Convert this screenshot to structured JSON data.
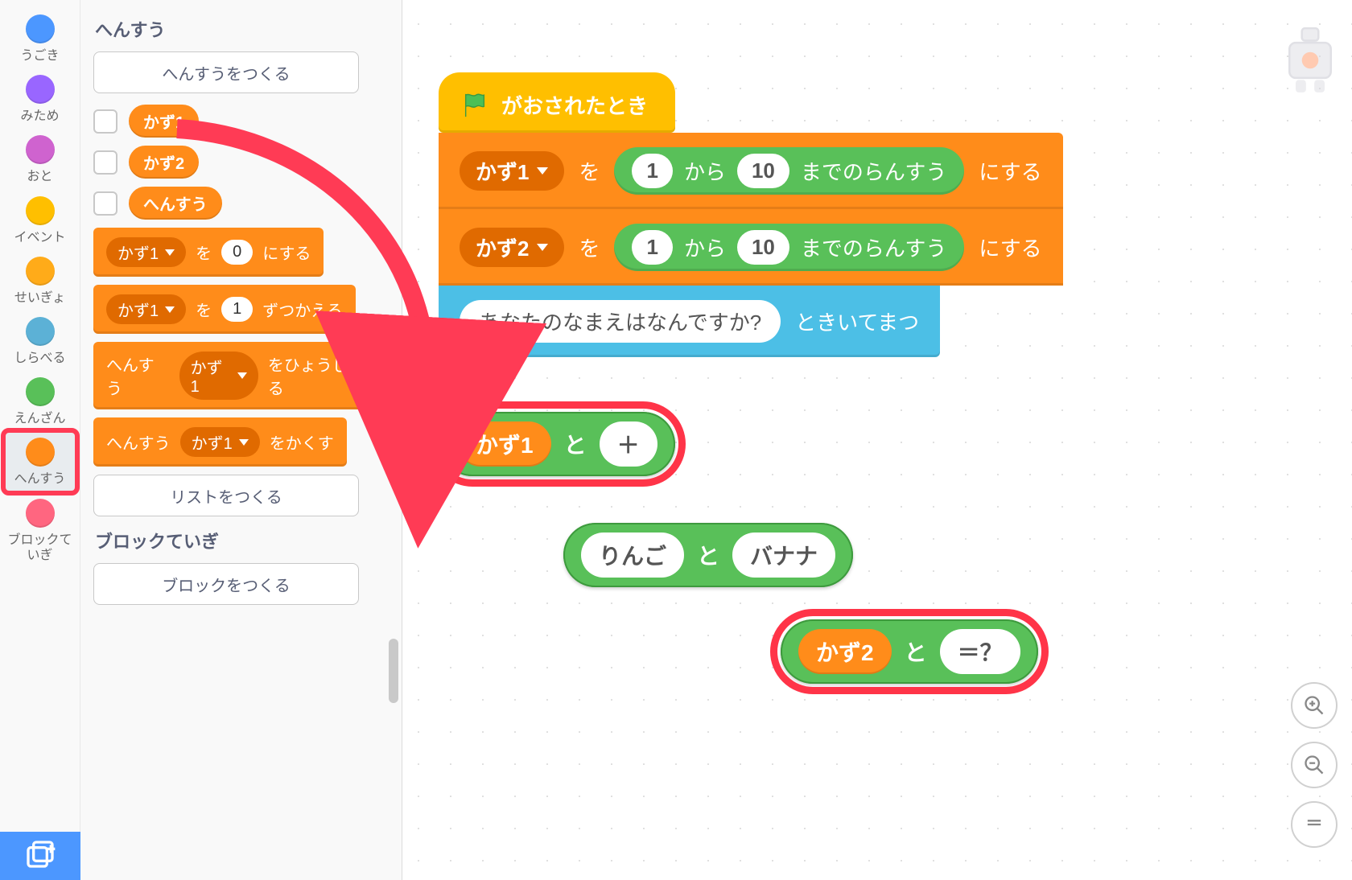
{
  "categories": [
    {
      "name": "うごき",
      "color": "#4C97FF"
    },
    {
      "name": "みため",
      "color": "#9966FF"
    },
    {
      "name": "おと",
      "color": "#CF63CF"
    },
    {
      "name": "イベント",
      "color": "#FFBF00"
    },
    {
      "name": "せいぎょ",
      "color": "#FFAB19"
    },
    {
      "name": "しらべる",
      "color": "#5CB1D6"
    },
    {
      "name": "えんざん",
      "color": "#59C059"
    },
    {
      "name": "へんすう",
      "color": "#FF8C1A",
      "selected": true
    },
    {
      "name": "ブロックていぎ",
      "color": "#FF6680"
    }
  ],
  "palette": {
    "variables_heading": "へんすう",
    "make_variable": "へんすうをつくる",
    "vars": [
      "かず1",
      "かず2",
      "へんすう"
    ],
    "block_set": {
      "dd": "かず1",
      "mid": "を",
      "val": "0",
      "suffix": "にする"
    },
    "block_change": {
      "dd": "かず1",
      "mid": "を",
      "val": "1",
      "suffix": "ずつかえる"
    },
    "block_show": {
      "prefix": "へんすう",
      "dd": "かず1",
      "suffix": "をひょうじする"
    },
    "block_hide": {
      "prefix": "へんすう",
      "dd": "かず1",
      "suffix": "をかくす"
    },
    "make_list": "リストをつくる",
    "block_def_heading": "ブロックていぎ",
    "make_block": "ブロックをつくる"
  },
  "script": {
    "hat_label": "がおされたとき",
    "set1": {
      "dd": "かず1",
      "mid": "を",
      "rand_from": "1",
      "rand_mid": "から",
      "rand_to": "10",
      "rand_suffix": "までのらんすう",
      "suffix": "にする"
    },
    "set2": {
      "dd": "かず2",
      "mid": "を",
      "rand_from": "1",
      "rand_mid": "から",
      "rand_to": "10",
      "rand_suffix": "までのらんすう",
      "suffix": "にする"
    },
    "ask": {
      "question": "あなたのなまえはなんですか?",
      "suffix": "ときいてまつ"
    }
  },
  "joins": {
    "j1": {
      "left_var": "かず1",
      "mid": "と",
      "right": "＋"
    },
    "j2": {
      "left": "りんご",
      "mid": "と",
      "right": "バナナ"
    },
    "j3": {
      "left_var": "かず2",
      "mid": "と",
      "right": "＝？"
    }
  },
  "icons": {
    "flag": "flag-icon",
    "zoom_in": "zoom-in-icon",
    "zoom_out": "zoom-out-icon",
    "zoom_reset": "zoom-reset-icon",
    "robot": "robot-icon",
    "extension": "extension-icon"
  }
}
